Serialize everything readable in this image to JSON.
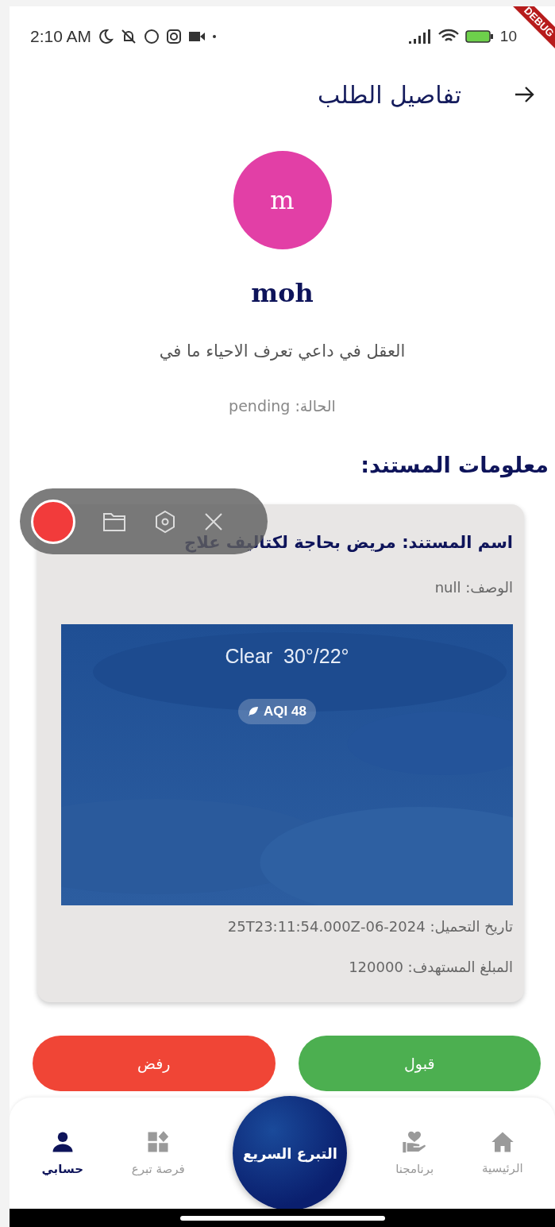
{
  "status_bar": {
    "time": "2:10 AM",
    "battery_text": "10"
  },
  "debug_banner": "DEBUG",
  "header": {
    "title": "تفاصيل الطلب"
  },
  "profile": {
    "initial": "m",
    "name": "moh",
    "description": "العقل في داعي تعرف الاحياء ما في",
    "status": "الحالة: pending"
  },
  "section_title": "معلومات المستند:",
  "document": {
    "name": "اسم المستند: مريض بحاجة لكتاليف علاج",
    "description": "الوصف: null",
    "image": {
      "kind": "picture",
      "weather": "Clear  30°/22°",
      "aqi": "AQI 48"
    },
    "upload_date": "تاريخ التحميل: 2024-06-25T23:11:54.000Z",
    "target_amount": "المبلغ المستهدف: 120000"
  },
  "actions": [
    {
      "label": "قبول",
      "kind": "accept"
    },
    {
      "label": "رفض",
      "kind": "reject"
    }
  ],
  "recorder": {
    "recording": true
  },
  "nav": {
    "items": [
      {
        "label": "الرئيسية",
        "kind": "home",
        "selected": false
      },
      {
        "label": "برنامجنا",
        "kind": "programs",
        "selected": false
      },
      {
        "label": "التبرع السريع",
        "kind": "quick",
        "selected": false
      },
      {
        "label": "فرصة تبرع",
        "kind": "opportunity",
        "selected": false
      },
      {
        "label": "حسابي",
        "kind": "account",
        "selected": true
      }
    ]
  }
}
